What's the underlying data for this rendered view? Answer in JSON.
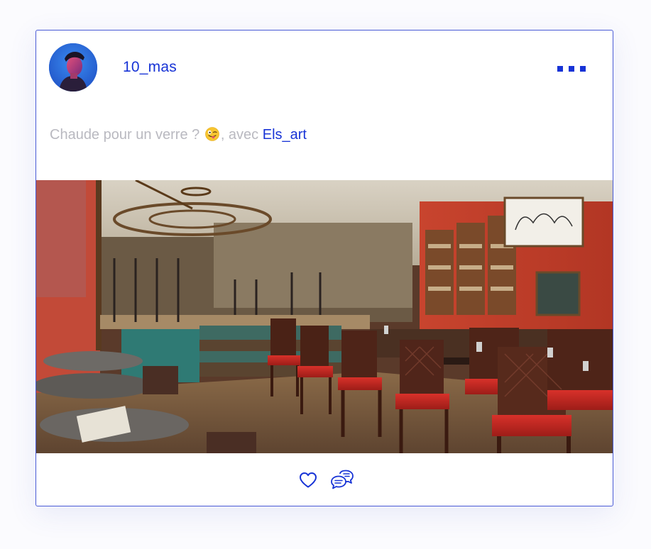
{
  "post": {
    "username": "10_mas",
    "caption_text": "Chaude pour un verre ? ",
    "caption_emoji": "winking-tongue-emoji",
    "caption_with": ", avec ",
    "caption_tag": "Els_art"
  },
  "actions": {
    "like_icon": "heart-icon",
    "comment_icon": "chat-bubbles-icon"
  },
  "colors": {
    "accent": "#1733d6",
    "caption_gray": "#b9b9c0",
    "card_border": "#4a5bd6"
  }
}
